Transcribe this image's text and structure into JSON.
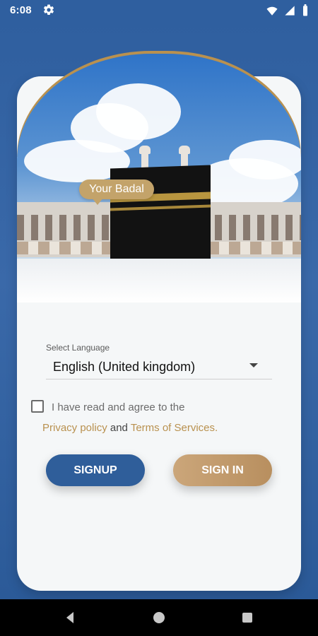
{
  "status_bar": {
    "time": "6:08",
    "icons": [
      "gear-icon",
      "wifi-icon",
      "signal-icon",
      "battery-icon"
    ]
  },
  "hero": {
    "badge_text": "Your Badal"
  },
  "form": {
    "select_language_label": "Select Language",
    "selected_language": "English (United kingdom)",
    "agree_text": "I have read and agree to the",
    "privacy_policy_label": "Privacy policy",
    "and_text": "and",
    "terms_label": "Terms of Services."
  },
  "buttons": {
    "signup": "SIGNUP",
    "signin": "SIGN IN"
  },
  "nav": {
    "icons": [
      "back-icon",
      "home-icon",
      "recents-icon"
    ]
  },
  "colors": {
    "primary_blue": "#2f5e9a",
    "gold": "#b9914f",
    "signin_gold": "#c6a173"
  }
}
